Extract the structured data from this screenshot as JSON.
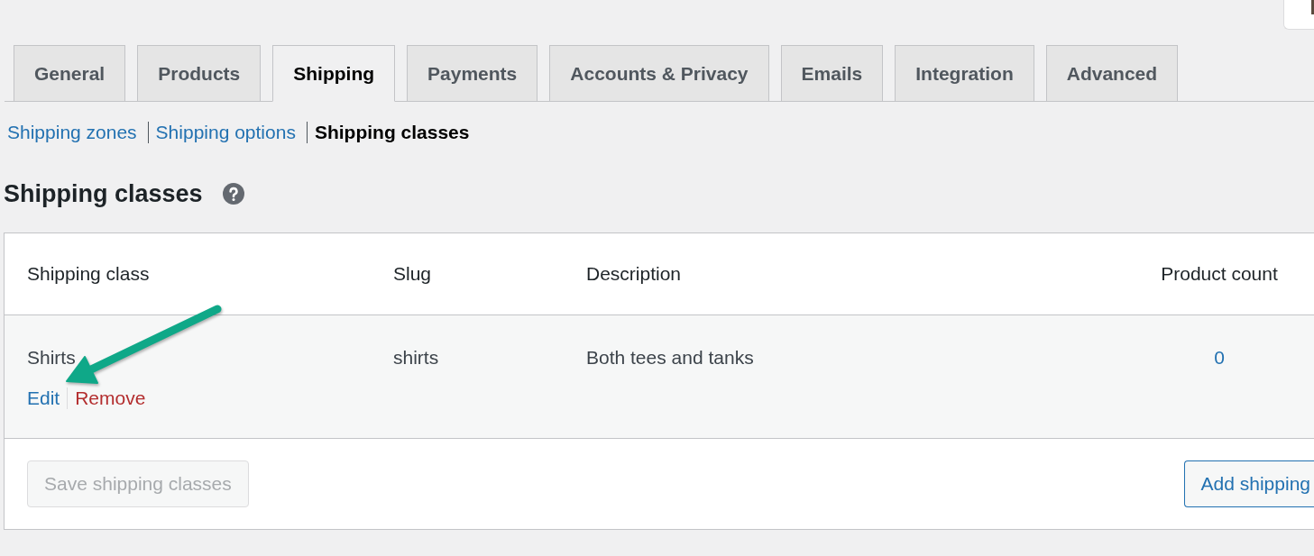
{
  "tabs": [
    {
      "label": "General",
      "selected": false
    },
    {
      "label": "Products",
      "selected": false
    },
    {
      "label": "Shipping",
      "selected": true
    },
    {
      "label": "Payments",
      "selected": false
    },
    {
      "label": "Accounts & Privacy",
      "selected": false
    },
    {
      "label": "Emails",
      "selected": false
    },
    {
      "label": "Integration",
      "selected": false
    },
    {
      "label": "Advanced",
      "selected": false
    }
  ],
  "subnav": [
    {
      "label": "Shipping zones",
      "selected": false
    },
    {
      "label": "Shipping options",
      "selected": false
    },
    {
      "label": "Shipping classes",
      "selected": true
    }
  ],
  "heading": {
    "title": "Shipping classes"
  },
  "table": {
    "columns": [
      "Shipping class",
      "Slug",
      "Description",
      "Product count"
    ],
    "rows": [
      {
        "name": "Shirts",
        "actions": [
          {
            "label": "Edit",
            "kind": "edit"
          },
          {
            "label": "Remove",
            "kind": "remove"
          }
        ],
        "slug": "shirts",
        "description": "Both tees and tanks",
        "product_count": "0"
      }
    ]
  },
  "footer": {
    "buttons": [
      {
        "label": "Save shipping classes",
        "disabled": true
      },
      {
        "label": "Add shipping",
        "disabled": false
      }
    ]
  }
}
